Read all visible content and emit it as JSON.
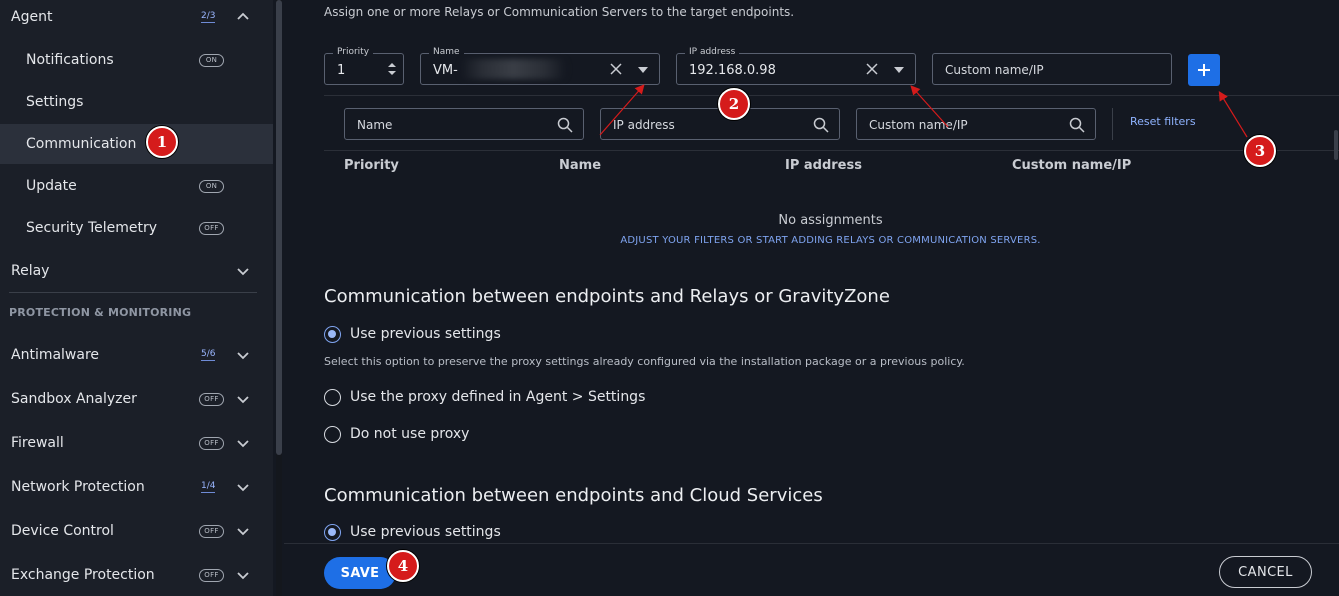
{
  "sidebar": {
    "agent": {
      "label": "Agent",
      "badge": "2/3"
    },
    "notifications": {
      "label": "Notifications",
      "pill": "ON"
    },
    "settings": {
      "label": "Settings"
    },
    "communication": {
      "label": "Communication"
    },
    "update": {
      "label": "Update",
      "pill": "ON"
    },
    "telemetry": {
      "label": "Security Telemetry",
      "pill": "OFF"
    },
    "relay": {
      "label": "Relay"
    },
    "section": "PROTECTION & MONITORING",
    "antimalware": {
      "label": "Antimalware",
      "badge": "5/6"
    },
    "sandbox": {
      "label": "Sandbox Analyzer",
      "pill": "OFF"
    },
    "firewall": {
      "label": "Firewall",
      "pill": "OFF"
    },
    "network": {
      "label": "Network Protection",
      "badge": "1/4"
    },
    "device": {
      "label": "Device Control",
      "pill": "OFF"
    },
    "exchange": {
      "label": "Exchange Protection",
      "pill": "OFF"
    }
  },
  "main": {
    "intro": "Assign one or more Relays or Communication Servers to the target endpoints.",
    "priority": {
      "label": "Priority",
      "value": "1"
    },
    "name": {
      "label": "Name",
      "value": "VM-"
    },
    "ip": {
      "label": "IP address",
      "value": "192.168.0.98"
    },
    "custom": {
      "placeholder": "Custom name/IP"
    },
    "plus": "+",
    "filters": {
      "name": "Name",
      "ip": "IP address",
      "custom": "Custom name/IP",
      "reset": "Reset filters"
    },
    "columns": [
      "Priority",
      "Name",
      "IP address",
      "Custom name/IP"
    ],
    "empty_title": "No assignments",
    "empty_sub": "ADJUST YOUR FILTERS OR START ADDING RELAYS OR COMMUNICATION SERVERS.",
    "section1": {
      "title": "Communication between endpoints and Relays or GravityZone",
      "opt1": "Use previous settings",
      "hint": "Select this option to preserve the proxy settings already configured via the installation package or a previous policy.",
      "opt2": "Use the proxy defined in Agent > Settings",
      "opt3": "Do not use proxy"
    },
    "section2": {
      "title": "Communication between endpoints and Cloud Services",
      "opt1": "Use previous settings"
    }
  },
  "footer": {
    "save": "SAVE",
    "cancel": "CANCEL"
  },
  "markers": [
    "1",
    "2",
    "3",
    "4"
  ],
  "colors": {
    "accent": "#1e6fe6",
    "marker": "#d51b1b",
    "link": "#8fb3ff"
  }
}
